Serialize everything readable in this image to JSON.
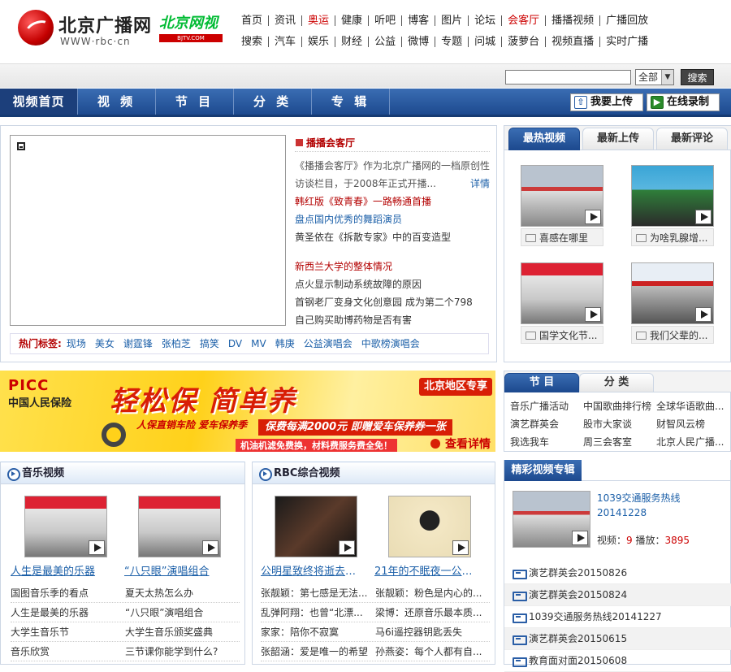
{
  "header": {
    "logo_text": "北京广播网",
    "logo_url": "WWW·rbc·cn",
    "logo2_text": "北京网视",
    "logo2_sub": "BJTV.COM",
    "nav_row1": [
      {
        "label": "首页",
        "red": false
      },
      {
        "label": "资讯",
        "red": false
      },
      {
        "label": "奥运",
        "red": true
      },
      {
        "label": "健康",
        "red": false
      },
      {
        "label": "听吧",
        "red": false
      },
      {
        "label": "博客",
        "red": false
      },
      {
        "label": "图片",
        "red": false
      },
      {
        "label": "论坛",
        "red": false
      },
      {
        "label": "会客厅",
        "red": true
      },
      {
        "label": "播播视频",
        "red": false
      },
      {
        "label": "广播回放",
        "red": false
      }
    ],
    "nav_row2": [
      {
        "label": "搜索",
        "red": false
      },
      {
        "label": "汽车",
        "red": false
      },
      {
        "label": "娱乐",
        "red": false
      },
      {
        "label": "财经",
        "red": false
      },
      {
        "label": "公益",
        "red": false
      },
      {
        "label": "微博",
        "red": false
      },
      {
        "label": "专题",
        "red": false
      },
      {
        "label": "问城",
        "red": false
      },
      {
        "label": "菠萝台",
        "red": false
      },
      {
        "label": "视频直播",
        "red": false
      },
      {
        "label": "实时广播",
        "red": false
      }
    ]
  },
  "search": {
    "value": "",
    "select_value": "全部",
    "button": "搜索"
  },
  "mainnav": {
    "items": [
      "视频首页",
      "视 频",
      "节 目",
      "分 类",
      "专 辑"
    ],
    "upload": "我要上传",
    "record": "在线录制"
  },
  "featured": {
    "title": "播播会客厅",
    "desc": "《播播会客厅》作为北京广播网的一档原创性访谈栏目，于2008年正式开播...",
    "more": "详情",
    "lines_a": [
      {
        "text": "韩红版《致青春》一路畅通首播",
        "style": "red"
      },
      {
        "text": "盘点国内优秀的舞蹈演员",
        "style": "blue"
      },
      {
        "text": "黄圣依在《拆散专家》中的百变造型",
        "style": ""
      }
    ],
    "lines_b": [
      {
        "text": "新西兰大学的整体情况",
        "style": "red"
      },
      {
        "text": "点火显示制动系统故障的原因",
        "style": ""
      },
      {
        "text": "首钢老厂变身文化创意园 成为第二个798",
        "style": ""
      },
      {
        "text": "自己购买助博药物是否有害",
        "style": ""
      }
    ],
    "tags_label": "热门标签:",
    "tags": [
      "现场",
      "美女",
      "谢霆锋",
      "张柏芝",
      "搞笑",
      "DV",
      "MV",
      "韩庚",
      "公益演唱会",
      "中歌榜演唱会"
    ]
  },
  "hot": {
    "tabs": [
      "最热视频",
      "最新上传",
      "最新评论"
    ],
    "videos": [
      "喜感在哪里",
      "为啥乳腺增...",
      "国学文化节...",
      "我们父辈的..."
    ]
  },
  "banner": {
    "brand": "PICC",
    "brand_cn": "中国人民保险",
    "slogan": "轻松保 简单养",
    "sub": "人保直销车险 爱车保养季",
    "ribbon": "保费每满2000元 即赠爱车保养券一张",
    "small": "机油机滤免费换，材料费服务费全免！",
    "region": "北京地区专享",
    "detail": "查看详情"
  },
  "programs": {
    "tabs": [
      "节 目",
      "分 类"
    ],
    "rows": [
      [
        "音乐广播活动",
        "中国歌曲排行榜",
        "全球华语歌曲..."
      ],
      [
        "演艺群英会",
        "股市大家谈",
        "财智风云榜"
      ],
      [
        "我选我车",
        "周三会客室",
        "北京人民广播..."
      ]
    ]
  },
  "music": {
    "title": "音乐视频",
    "videos": [
      "人生是最美的乐器",
      "“八只眼”演唱组合"
    ],
    "rows": [
      [
        "国图音乐季的看点",
        "夏天太热怎么办"
      ],
      [
        "人生是最美的乐器",
        "“八只眼”演唱组合"
      ],
      [
        "大学生音乐节",
        "大学生音乐颁奖盛典"
      ],
      [
        "音乐欣赏",
        "三节课你能学到什么?"
      ]
    ]
  },
  "rbc": {
    "title": "RBC综合视频",
    "videos": [
      "公明星致终将逝去的《...",
      "21年的不眠夜一公明星..."
    ],
    "rows": [
      [
        "张靓颖：第七感是无法...",
        "张靓颖：粉色是内心的..."
      ],
      [
        "乱弹阿翔：也曾“北漂...",
        "梁博：还原音乐最本质..."
      ],
      [
        "家家：陪你不寂寞",
        "马6i遥控器钥匙丢失"
      ],
      [
        "张韶涵：爱是唯一的希望",
        "孙燕姿：每个人都有自..."
      ]
    ]
  },
  "albums": {
    "title": "精彩视频专辑",
    "featured_title": "1039交通服务热线20141228",
    "views_label": "视频：",
    "views": "9",
    "plays_label": "播放：",
    "plays": "3895",
    "list": [
      "演艺群英会20150826",
      "演艺群英会20150824",
      "1039交通服务热线20141227",
      "演艺群英会20150615",
      "教育面对面20150608"
    ]
  }
}
